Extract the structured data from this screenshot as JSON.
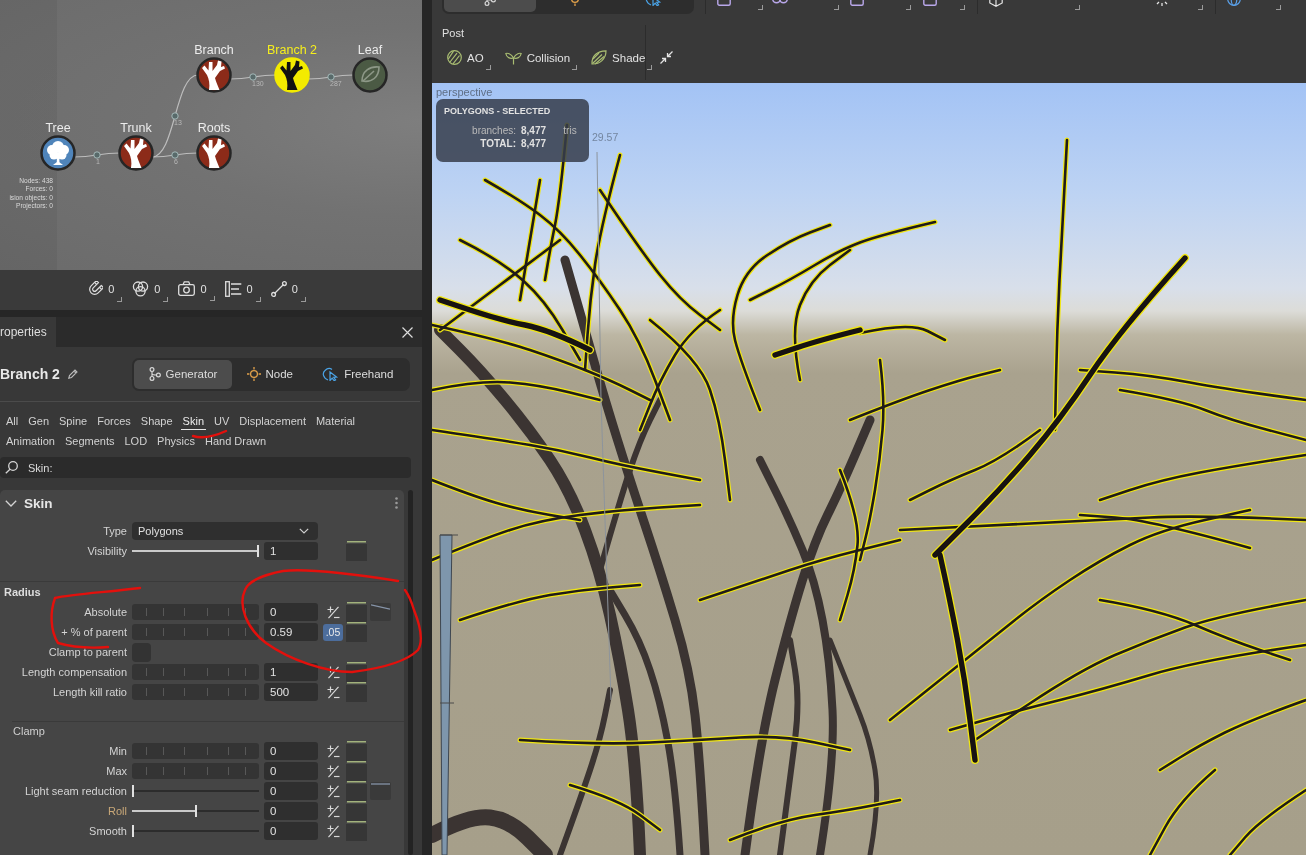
{
  "node_graph": {
    "root": {
      "label": "Tree",
      "kind": "tree",
      "selected": false,
      "children": [
        {
          "label": "Trunk",
          "kind": "branch",
          "selected": false,
          "link_count": "1",
          "children": [
            {
              "label": "Branch",
              "kind": "branch",
              "selected": false,
              "link_count": "13",
              "children": [
                {
                  "label": "Branch 2",
                  "kind": "branch",
                  "selected": true,
                  "link_count": "130",
                  "children": [
                    {
                      "label": "Leaf",
                      "kind": "leaf",
                      "selected": false,
                      "link_count": "287"
                    }
                  ]
                }
              ]
            },
            {
              "label": "Roots",
              "kind": "branch",
              "selected": false,
              "link_count": "6"
            }
          ]
        }
      ]
    },
    "stats": [
      "Nodes: 438",
      "Forces: 0",
      "ision objects: 0",
      "Projectors: 0"
    ]
  },
  "counters": [
    {
      "kind": "magnet",
      "value": "0"
    },
    {
      "kind": "circles",
      "value": "0"
    },
    {
      "kind": "camera",
      "value": "0"
    },
    {
      "kind": "bars",
      "value": "0"
    },
    {
      "kind": "segment",
      "value": "0"
    }
  ],
  "properties": {
    "tab": "roperties",
    "title": "Branch 2",
    "modes": [
      {
        "label": "Generator",
        "kind": "generator",
        "selected": true
      },
      {
        "label": "Node",
        "kind": "node",
        "selected": false
      },
      {
        "label": "Freehand",
        "kind": "freehand",
        "selected": false
      }
    ],
    "category_rows": [
      [
        {
          "label": "All",
          "selected": false
        },
        {
          "label": "Gen",
          "selected": false
        },
        {
          "label": "Spine",
          "selected": false
        },
        {
          "label": "Forces",
          "selected": false
        },
        {
          "label": "Shape",
          "selected": false
        },
        {
          "label": "Skin",
          "selected": true
        },
        {
          "label": "UV",
          "selected": false
        },
        {
          "label": "Displacement",
          "selected": false
        },
        {
          "label": "Material",
          "selected": false
        }
      ],
      [
        {
          "label": "Animation",
          "selected": false
        },
        {
          "label": "Segments",
          "selected": false
        },
        {
          "label": "LOD",
          "selected": false
        },
        {
          "label": "Physics",
          "selected": false
        },
        {
          "label": "Hand Drawn",
          "selected": false
        }
      ]
    ],
    "search": {
      "value": "Skin:"
    },
    "section": {
      "title": "Skin",
      "expanded": true,
      "groups": [
        {
          "kind": "plain",
          "rows": [
            {
              "label": "Type",
              "kind": "dropdown",
              "value": "Polygons",
              "modified": false,
              "plus_minus": false,
              "animatable": false
            },
            {
              "label": "Visibility",
              "kind": "slider",
              "level": 1,
              "value": "1",
              "modified": false,
              "plus_minus": false,
              "animatable": true
            }
          ]
        },
        {
          "kind": "group",
          "title": "Radius",
          "rows": [
            {
              "label": "Absolute",
              "kind": "tick_slider",
              "value": "0",
              "modified": false,
              "plus_minus": true,
              "animatable": true,
              "curve": {
                "kind": "falling"
              }
            },
            {
              "label": "+ % of parent",
              "kind": "tick_slider",
              "value": "0.59",
              "badge": ".05",
              "modified": false,
              "plus_minus": false,
              "animatable": true
            },
            {
              "label": "Clamp to parent",
              "kind": "checkbox",
              "checked": false,
              "modified": false,
              "plus_minus": false,
              "animatable": false
            },
            {
              "label": "Length compensation",
              "kind": "tick_slider",
              "value": "1",
              "modified": false,
              "plus_minus": true,
              "animatable": true
            },
            {
              "label": "Length kill ratio",
              "kind": "tick_slider",
              "value": "500",
              "modified": false,
              "plus_minus": true,
              "animatable": true
            }
          ]
        },
        {
          "kind": "subgroup",
          "title": "Clamp",
          "rows": [
            {
              "label": "Min",
              "kind": "tick_slider",
              "value": "0",
              "modified": false,
              "plus_minus": true,
              "animatable": true
            },
            {
              "label": "Max",
              "kind": "tick_slider",
              "value": "0",
              "modified": false,
              "plus_minus": true,
              "animatable": true
            },
            {
              "label": "Light seam reduction",
              "kind": "slider",
              "level": 0,
              "value": "0",
              "modified": false,
              "plus_minus": true,
              "animatable": true,
              "curve": {
                "kind": "flat"
              }
            },
            {
              "label": "Roll",
              "kind": "slider",
              "level": 0.5,
              "value": "0",
              "modified": true,
              "plus_minus": true,
              "animatable": true
            },
            {
              "label": "Smooth",
              "kind": "slider",
              "level": 0,
              "value": "0",
              "modified": false,
              "plus_minus": true,
              "animatable": true
            }
          ]
        }
      ]
    }
  },
  "toolbar": {
    "modes": [
      {
        "kind": "generator",
        "selected": true
      },
      {
        "kind": "node",
        "selected": false
      },
      {
        "kind": "freehand",
        "selected": false
      }
    ],
    "post": {
      "label": "Post",
      "buttons": [
        {
          "label": "AO",
          "kind": "ao"
        },
        {
          "label": "Collision",
          "kind": "collision"
        },
        {
          "label": "Shade",
          "kind": "shade"
        }
      ]
    }
  },
  "viewport": {
    "view_label": "perspective",
    "info": {
      "title": "POLYGONS - SELECTED",
      "rows": [
        {
          "kind": "item",
          "label": "branches:",
          "value": "8,477",
          "unit": "tris"
        },
        {
          "kind": "total",
          "label": "TOTAL:",
          "value": "8,477"
        }
      ]
    },
    "measure": "29.57"
  }
}
